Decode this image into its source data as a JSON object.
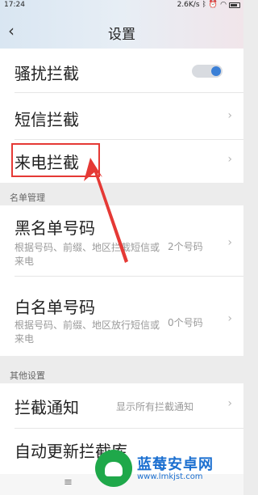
{
  "status": {
    "time": "17:24",
    "net_speed": "2.6K/s",
    "icons": [
      "bluetooth-icon",
      "alarm-icon",
      "wifi-icon",
      "battery-icon"
    ]
  },
  "header": {
    "back_icon": "chevron-left",
    "title": "设置"
  },
  "rows": {
    "harass": {
      "label": "骚扰拦截",
      "toggle_on": true
    },
    "sms": {
      "label": "短信拦截"
    },
    "call": {
      "label": "来电拦截"
    }
  },
  "sections": {
    "list": "名单管理",
    "other": "其他设置"
  },
  "blacklist": {
    "label": "黑名单号码",
    "desc": "根据号码、前缀、地区拦截短信或来电",
    "count": "2个号码"
  },
  "whitelist": {
    "label": "白名单号码",
    "desc": "根据号码、前缀、地区放行短信或来电",
    "count": "0个号码"
  },
  "notify": {
    "label": "拦截通知",
    "value": "显示所有拦截通知"
  },
  "autoupdate": {
    "label": "自动更新拦截库"
  },
  "watermark": {
    "name": "蓝莓安卓网",
    "url": "www.lmkjst.com"
  },
  "colors": {
    "accent": "#3a7fd6",
    "highlight": "#e53935",
    "watermark": "#1b6fd0"
  }
}
